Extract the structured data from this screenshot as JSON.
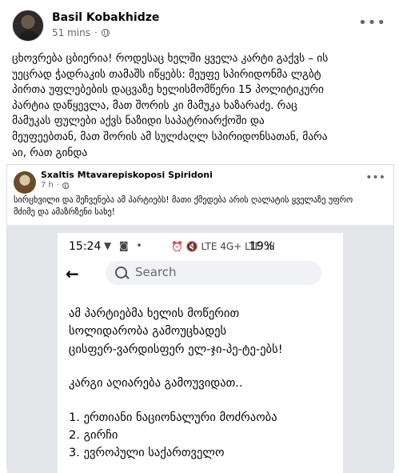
{
  "post": {
    "author": "Basil Kobakhidze",
    "time": "51 mins",
    "separator": "·",
    "privacy_icon": "globe-icon",
    "more_label": "•••",
    "text_lines": [
      "ცხოვრება ცბიერია! როდესაც ხელში ყველა კარტი გაქვს – ის",
      "უეცრად ჭადრაკის თამაშს იწყებს: მეუფე სპირიდონმა ლგბტ",
      "პირთა უფლებების დაცვაზე ხელისმომწერი 15 პოლიტიკური",
      "პარტია დაწყევლა, მათ შორის კი მამუკა ხაზარაძე. რაც",
      "მამუკას ფულები აქვს ნაზიდი საპატრიარქოში და",
      "მეუფეებთან, მათ შორის ამ სულძაღლ სპირიდონსათან, მარა",
      "აი, რათ გინდა"
    ]
  },
  "shared_post": {
    "author": "Sxaltis Mtavarepiskoposi Spiridoni",
    "time": "7 h",
    "separator": "·",
    "privacy_icon": "globe-icon",
    "more_label": "•••",
    "text_lines": [
      "სირცხვილი და შეჩვენება ამ პარტიებს! მათი ქმედება არის ღალატის ყველაზე უფრო",
      "მძიმე და ამაზრზენი სახე!"
    ]
  },
  "phone": {
    "time": "15:24",
    "left_icons": "▼ ◙ •",
    "right_icons": "⏰ 🔇 LTE 4G+ LTE .ıll",
    "battery": "19%",
    "search_placeholder": "Search",
    "back_icon": "arrow-left-icon",
    "message_lines": [
      "ამ პარტიებმა ხელის მოწერით",
      "სოლიდარობა გამოუცხადეს",
      "ცისფერ-ვარდისფერ ელ-ჯი-პე-ტე-ებს!",
      "",
      "კარგი აღიარება გამოუვიდათ..",
      "",
      "1. ერთიანი ნაციონალური მოძრაობა",
      "2. გირჩი",
      "3. ევროპული საქართველო"
    ]
  }
}
